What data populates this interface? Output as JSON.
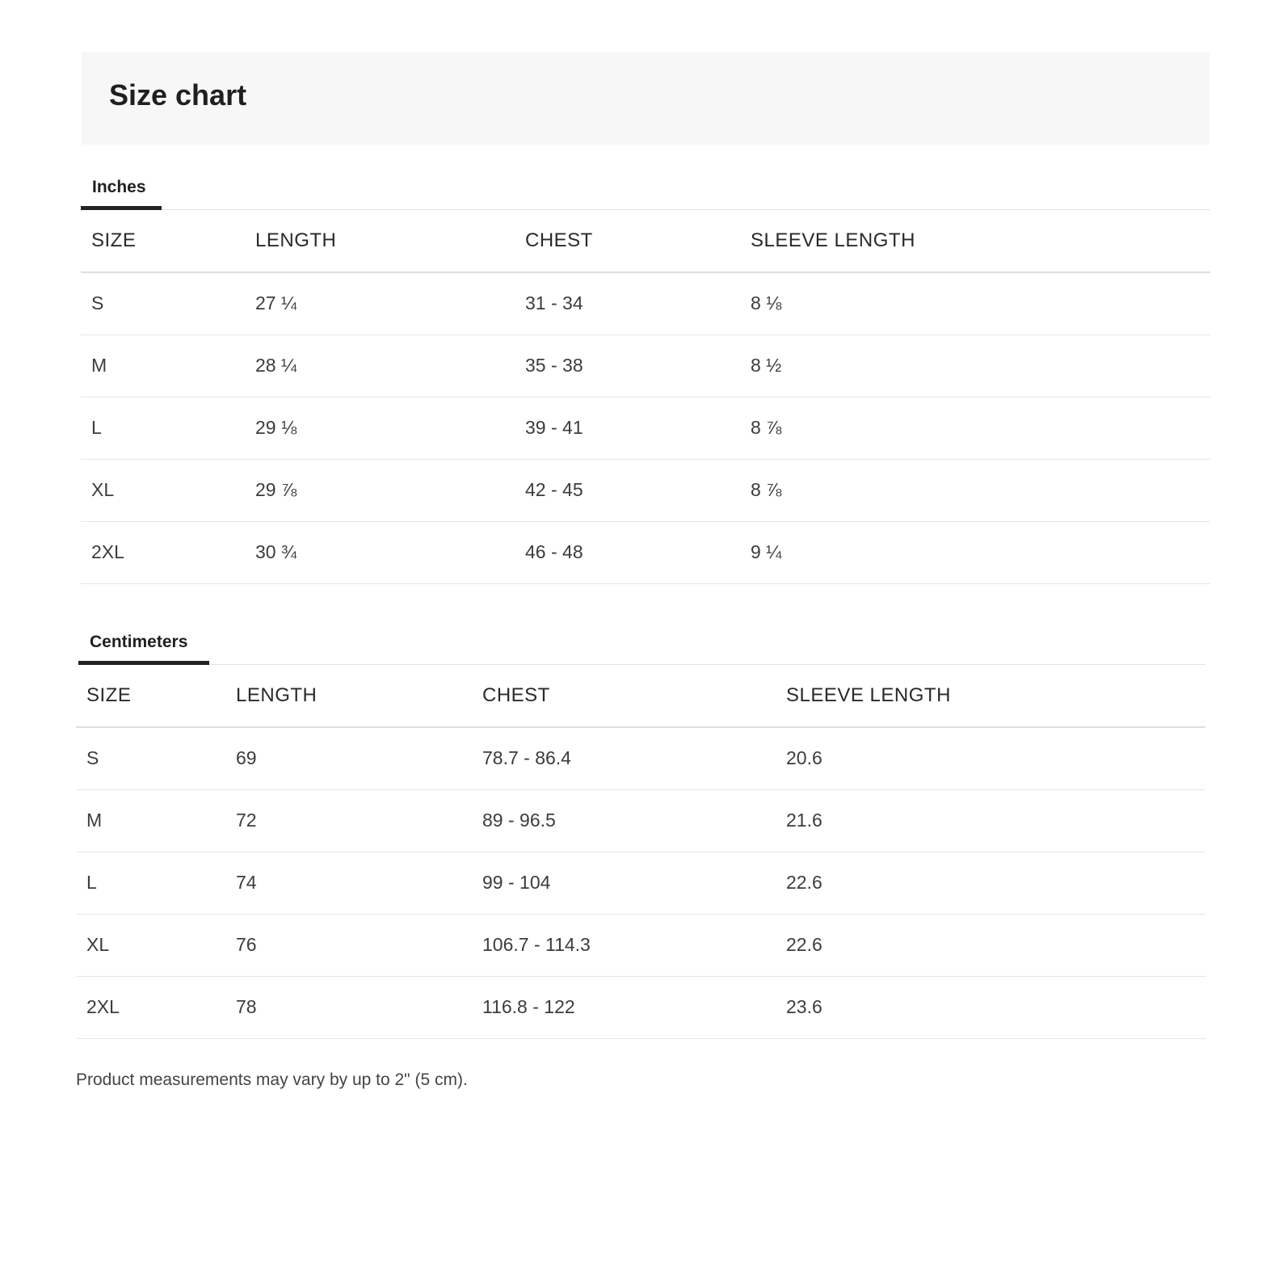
{
  "title": "Size chart",
  "inches": {
    "tab_label": "Inches",
    "headers": [
      "SIZE",
      "LENGTH",
      "CHEST",
      "SLEEVE LENGTH"
    ],
    "rows": [
      [
        "S",
        "27 ¼",
        "31 - 34",
        "8 ⅛"
      ],
      [
        "M",
        "28 ¼",
        "35 - 38",
        "8 ½"
      ],
      [
        "L",
        "29 ⅛",
        "39 - 41",
        "8 ⅞"
      ],
      [
        "XL",
        "29 ⅞",
        "42 - 45",
        "8 ⅞"
      ],
      [
        "2XL",
        "30 ¾",
        "46 - 48",
        "9 ¼"
      ]
    ]
  },
  "centimeters": {
    "tab_label": "Centimeters",
    "headers": [
      "SIZE",
      "LENGTH",
      "CHEST",
      "SLEEVE LENGTH"
    ],
    "rows": [
      [
        "S",
        "69",
        "78.7 - 86.4",
        "20.6"
      ],
      [
        "M",
        "72",
        "89 - 96.5",
        "21.6"
      ],
      [
        "L",
        "74",
        "99 - 104",
        "22.6"
      ],
      [
        "XL",
        "76",
        "106.7 - 114.3",
        "22.6"
      ],
      [
        "2XL",
        "78",
        "116.8 - 122",
        "23.6"
      ]
    ]
  },
  "note": "Product measurements may vary by up to 2\" (5 cm)."
}
